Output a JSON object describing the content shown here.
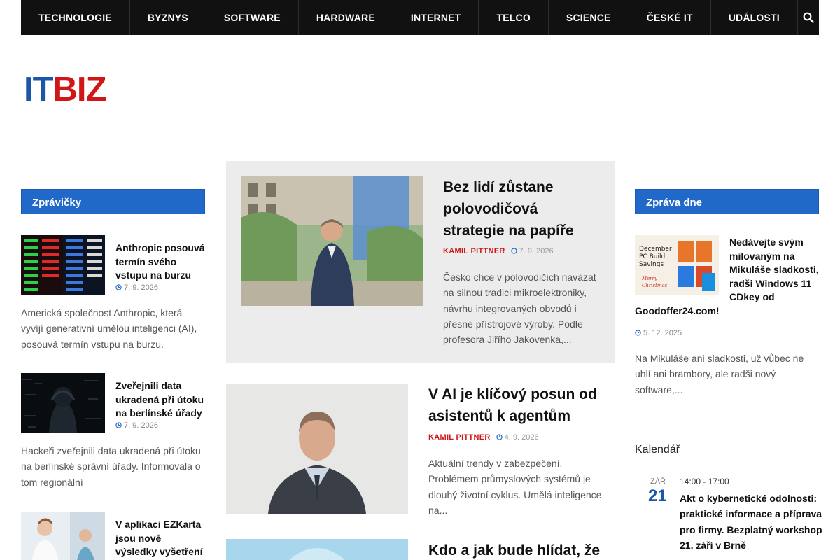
{
  "nav": {
    "items": [
      "TECHNOLOGIE",
      "BYZNYS",
      "SOFTWARE",
      "HARDWARE",
      "INTERNET",
      "TELCO",
      "SCIENCE",
      "ČESKÉ IT",
      "UDÁLOSTI"
    ],
    "search_icon": "search-icon"
  },
  "logo": {
    "part1": "IT",
    "part2": "BIZ"
  },
  "left_block": {
    "title": "Zprávičky",
    "posts": [
      {
        "title": "Anthropic posouvá termín svého vstupu na burzu",
        "date": "7. 9. 2026",
        "excerpt": "Americká společnost Anthropic, která vyvíjí generativní umělou inteligenci (AI), posouvá termín vstupu na burzu."
      },
      {
        "title": "Zveřejnili data ukradená při útoku na berlínské úřady",
        "date": "7. 9. 2026",
        "excerpt": "Hackeři zveřejnili data ukradená při útoku na berlínské správní úřady. Informovala o tom regionální"
      },
      {
        "title": "V aplikaci EZKarta jsou nově výsledky vyšetření i dostupná prevence",
        "date": "",
        "excerpt": ""
      }
    ]
  },
  "featured": {
    "title": "Bez lidí zůstane polovodičová strategie na papíře",
    "author": "KAMIL PITTNER",
    "date": "7. 9. 2026",
    "excerpt": "Česko chce v polovodičích navázat na silnou tradici mikroelektroniky, návrhu integrovaných obvodů i přesné přístrojové výroby. Podle profesora Jiřího Jakovenka,..."
  },
  "list": [
    {
      "title": "V AI je klíčový posun od asistentů k agentům",
      "author": "KAMIL PITTNER",
      "date": "4. 9. 2026",
      "excerpt": "Aktuální trendy v zabezpečení. Problémem průmyslových systémů je dlouhý životní cyklus. Umělá inteligence na..."
    },
    {
      "title": "Kdo a jak bude hlídat, že",
      "author": "",
      "date": "",
      "excerpt": ""
    }
  ],
  "right_block": {
    "title": "Zpráva dne",
    "post": {
      "title": "Nedávejte svým milovaným na Mikuláše sladkosti, radši Windows 11 CDkey od Goodoffer24.com!",
      "date": "5. 12. 2025",
      "excerpt": "Na Mikuláše ani sladkosti, už vůbec ne uhlí ani brambory, ale radši nový software,...",
      "thumb_text": {
        "line1": "December",
        "line2": "PC Build",
        "line3": "Savings",
        "line4": "Merry",
        "line5": "Christmas"
      }
    }
  },
  "calendar": {
    "heading": "Kalendář",
    "event": {
      "month": "ZÁŘ",
      "day": "21",
      "time": "14:00 - 17:00",
      "title": "Akt o kybernetické odolnosti: praktické informace a příprava pro firmy. Bezplatný workshop 21. září v Brně"
    }
  },
  "colors": {
    "nav_bg": "#111111",
    "accent_blue": "#2069c9",
    "logo_blue": "#1b57a6",
    "logo_red": "#d01717",
    "author_red": "#d01717"
  }
}
